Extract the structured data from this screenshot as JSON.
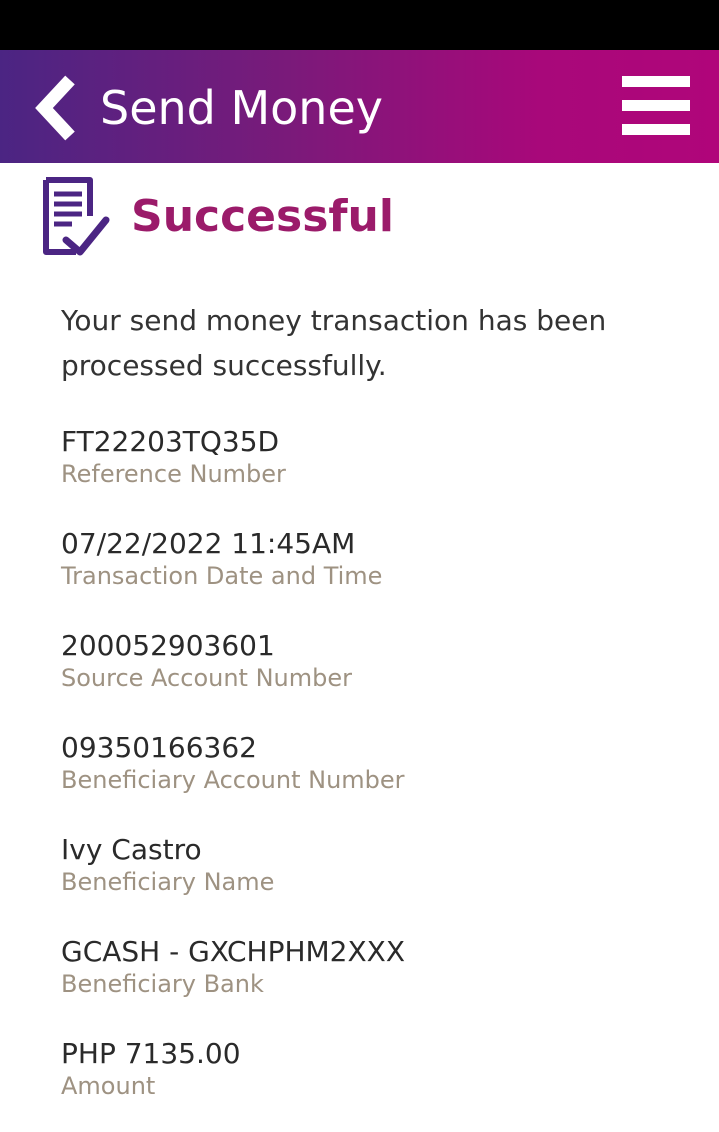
{
  "header": {
    "title": "Send Money",
    "back_icon": "chevron-left-icon",
    "menu_icon": "hamburger-menu-icon"
  },
  "status": {
    "title": "Successful",
    "icon": "document-check-icon",
    "message": "Your send money transaction has been processed successfully."
  },
  "details": {
    "reference": {
      "value": "FT22203TQ35D",
      "label": "Reference Number"
    },
    "datetime": {
      "value": "07/22/2022 11:45AM",
      "label": "Transaction Date and Time"
    },
    "source_account": {
      "value": "200052903601",
      "label": "Source Account Number"
    },
    "beneficiary_account": {
      "value": "09350166362",
      "label": "Beneficiary Account Number"
    },
    "beneficiary_name": {
      "value": "Ivy Castro",
      "label": "Beneficiary Name"
    },
    "beneficiary_bank": {
      "value": "GCASH - GXCHPHM2XXX",
      "label": "Beneficiary Bank"
    },
    "amount": {
      "value": "PHP 7135.00",
      "label": "Amount"
    }
  },
  "colors": {
    "header_gradient_start": "#4b2583",
    "header_gradient_end": "#b0057a",
    "accent": "#9b1b6a",
    "icon": "#4b2583",
    "label": "#9e9282"
  }
}
